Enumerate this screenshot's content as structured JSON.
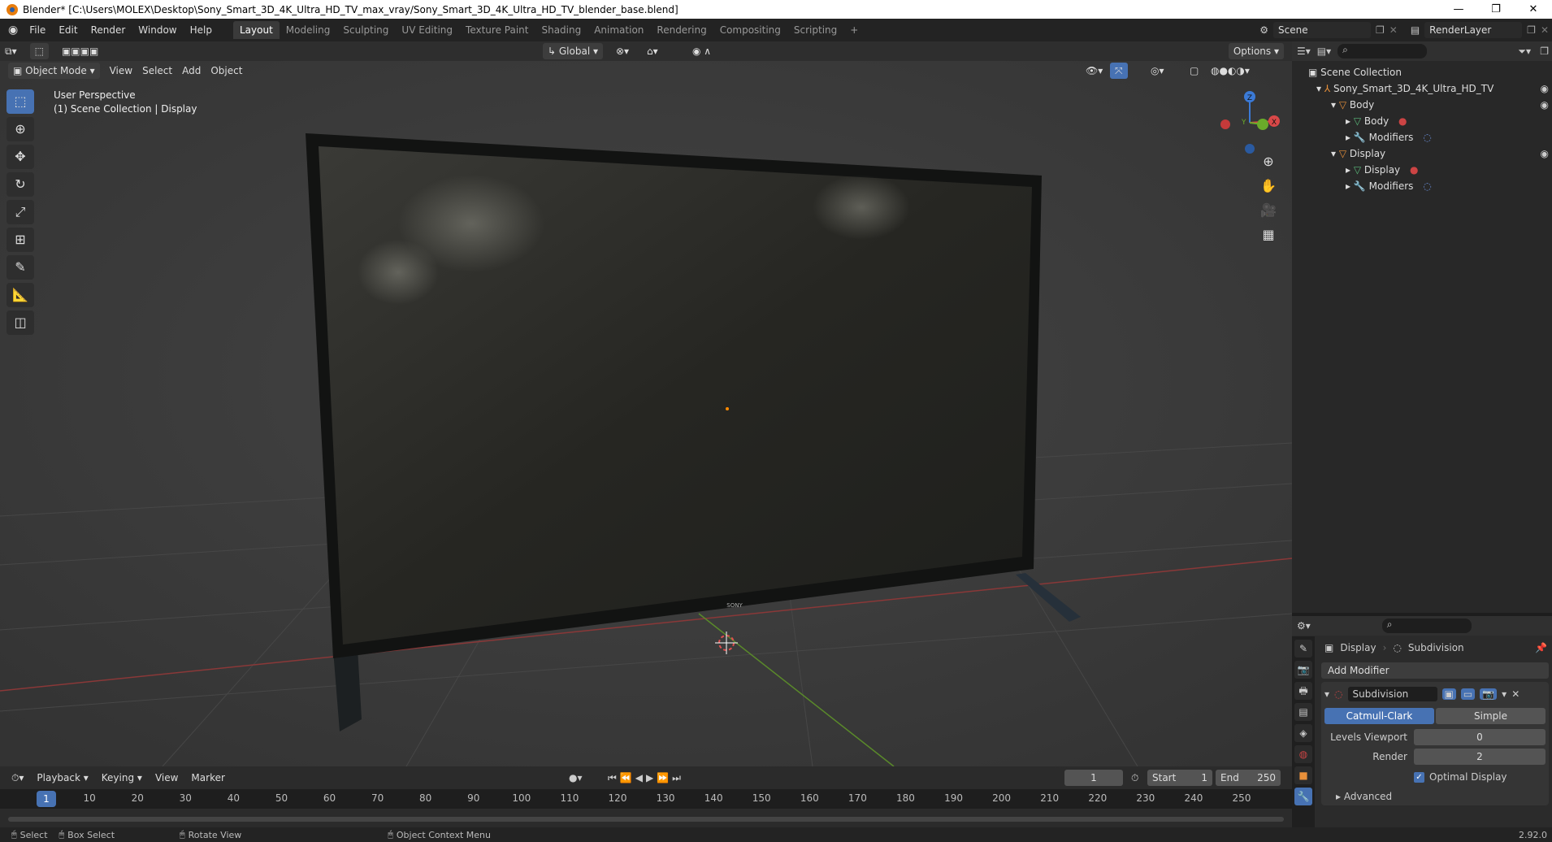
{
  "window": {
    "title": "Blender* [C:\\Users\\MOLEX\\Desktop\\Sony_Smart_3D_4K_Ultra_HD_TV_max_vray/Sony_Smart_3D_4K_Ultra_HD_TV_blender_base.blend]"
  },
  "menu": [
    "File",
    "Edit",
    "Render",
    "Window",
    "Help"
  ],
  "workspaces": [
    "Layout",
    "Modeling",
    "Sculpting",
    "UV Editing",
    "Texture Paint",
    "Shading",
    "Animation",
    "Rendering",
    "Compositing",
    "Scripting"
  ],
  "active_workspace": "Layout",
  "scene": {
    "name": "Scene",
    "render_layer": "RenderLayer"
  },
  "viewport_header": {
    "transform_orientation": "Global",
    "options": "Options"
  },
  "viewport_menu": {
    "mode": "Object Mode",
    "items": [
      "View",
      "Select",
      "Add",
      "Object"
    ]
  },
  "viewport_info": {
    "line1": "User Perspective",
    "line2": "(1) Scene Collection | Display"
  },
  "gizmo_axes": {
    "x": "X",
    "y": "Y",
    "z": "Z"
  },
  "model_brand": "SONY",
  "outliner": {
    "rows": [
      {
        "label": "Scene Collection",
        "indent": 0
      },
      {
        "label": "Sony_Smart_3D_4K_Ultra_HD_TV",
        "indent": 1
      },
      {
        "label": "Body",
        "indent": 2
      },
      {
        "label": "Body",
        "indent": 3
      },
      {
        "label": "Modifiers",
        "indent": 3
      },
      {
        "label": "Display",
        "indent": 2
      },
      {
        "label": "Display",
        "indent": 3
      },
      {
        "label": "Modifiers",
        "indent": 3
      }
    ]
  },
  "properties": {
    "breadcrumb_object": "Display",
    "breadcrumb_modifier": "Subdivision",
    "add_modifier": "Add Modifier",
    "modifier_name": "Subdivision",
    "type_options": [
      "Catmull-Clark",
      "Simple"
    ],
    "type_selected": "Catmull-Clark",
    "levels_viewport_label": "Levels Viewport",
    "levels_viewport": "0",
    "render_label": "Render",
    "render": "2",
    "optimal_display": "Optimal Display",
    "advanced": "Advanced"
  },
  "timeline": {
    "menus": [
      "Playback",
      "Keying",
      "View",
      "Marker"
    ],
    "current_frame": "1",
    "start_label": "Start",
    "start": "1",
    "end_label": "End",
    "end": "250",
    "ticks": [
      "10",
      "20",
      "30",
      "40",
      "50",
      "60",
      "70",
      "80",
      "90",
      "100",
      "110",
      "120",
      "130",
      "140",
      "150",
      "160",
      "170",
      "180",
      "190",
      "200",
      "210",
      "220",
      "230",
      "240",
      "250"
    ]
  },
  "statusbar": {
    "select": "Select",
    "box_select": "Box Select",
    "rotate_view": "Rotate View",
    "context_menu": "Object Context Menu",
    "version": "2.92.0"
  }
}
